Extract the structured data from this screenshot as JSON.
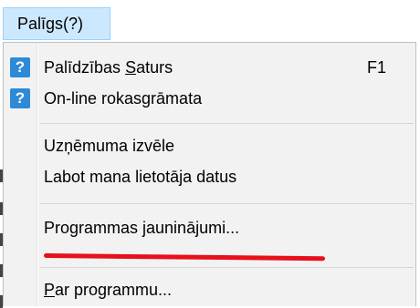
{
  "menubar": {
    "help_menu": "Palīgs(?)"
  },
  "menu": {
    "help_contents": {
      "icon": "help-icon",
      "label_before": "Palīdzības ",
      "label_mnemonic": "S",
      "label_after": "aturs",
      "shortcut": "F1"
    },
    "online_manual": {
      "icon": "help-icon",
      "label": "On-line rokasgrāmata"
    },
    "company_select": {
      "label": "Uzņēmuma izvēle"
    },
    "edit_user_data": {
      "label": "Labot mana lietotāja datus"
    },
    "program_updates": {
      "label": "Programmas jauninājumi..."
    },
    "about": {
      "label_mnemonic": "P",
      "label_after": "ar programmu..."
    }
  },
  "colors": {
    "menubar_highlight": "#cce8ff",
    "menu_background": "#f2f2f2",
    "icon_blue": "#2e8ad8",
    "annotation_red": "#e8101b"
  }
}
